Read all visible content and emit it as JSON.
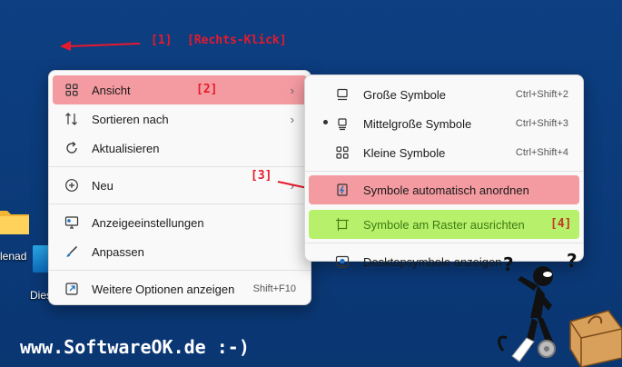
{
  "annotations": {
    "step1": "[1]",
    "rechts_klick": "[Rechts-Klick]",
    "step2": "[2]",
    "step3": "[3]",
    "step4": "[4]"
  },
  "desktop": {
    "label_1": "lenad",
    "label_2": "Dies"
  },
  "context_menu": {
    "items": [
      {
        "label": "Ansicht",
        "icon": "grid-icon"
      },
      {
        "label": "Sortieren nach",
        "icon": "sort-icon"
      },
      {
        "label": "Aktualisieren",
        "icon": "refresh-icon"
      },
      {
        "label": "Neu",
        "icon": "plus-circle-icon"
      },
      {
        "label": "Anzeigeeinstellungen",
        "icon": "display-settings-icon"
      },
      {
        "label": "Anpassen",
        "icon": "brush-icon"
      },
      {
        "label": "Weitere Optionen anzeigen",
        "icon": "more-options-icon",
        "shortcut": "Shift+F10"
      }
    ]
  },
  "submenu": {
    "items": [
      {
        "label": "Große Symbole",
        "icon": "large-icons-icon",
        "shortcut": "Ctrl+Shift+2"
      },
      {
        "label": "Mittelgroße Symbole",
        "icon": "medium-icons-icon",
        "shortcut": "Ctrl+Shift+3"
      },
      {
        "label": "Kleine Symbole",
        "icon": "small-icons-icon",
        "shortcut": "Ctrl+Shift+4"
      },
      {
        "label": "Symbole automatisch anordnen",
        "icon": "auto-arrange-icon"
      },
      {
        "label": "Symbole am Raster ausrichten",
        "icon": "align-grid-icon"
      },
      {
        "label": "Desktopsymbole anzeigen",
        "icon": "show-desktop-icons-icon"
      }
    ]
  },
  "watermark": "www.SoftwareOK.de :-)",
  "colors": {
    "desktop_bg": "#0b3a78",
    "highlight_red": "#f49ba1",
    "highlight_green": "#b7f06a",
    "annotation_red": "#e8192c"
  }
}
